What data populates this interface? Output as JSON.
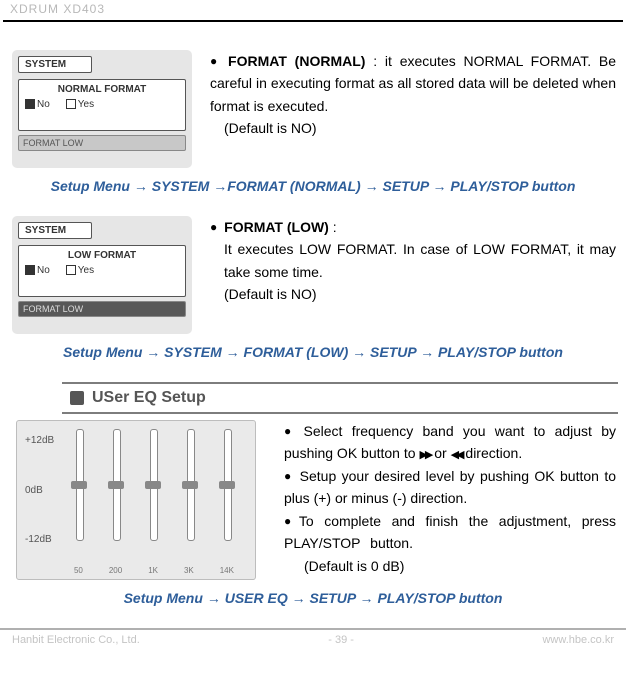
{
  "header": {
    "product": "XDRUM XD403"
  },
  "sections": {
    "format_normal": {
      "thumb": {
        "panel": "SYSTEM",
        "title": "NORMAL FORMAT",
        "opt_no": "No",
        "opt_yes": "Yes",
        "footer": "FORMAT LOW"
      },
      "heading": "FORMAT (NORMAL)",
      "body_line1": " : it executes NORMAL FORMAT. Be careful in executing format as all stored data will be deleted when format is executed.",
      "default": "(Default is NO)"
    },
    "format_low": {
      "thumb": {
        "panel": "SYSTEM",
        "title": "LOW FORMAT",
        "opt_no": "No",
        "opt_yes": "Yes",
        "footer": "FORMAT LOW"
      },
      "heading": "FORMAT (LOW)",
      "heading_suffix": " :",
      "body_line1": "It executes LOW FORMAT. In case of LOW FORMAT, it may take some time.",
      "default": "(Default is NO)"
    },
    "user_eq": {
      "bar_title": "USer EQ Setup",
      "thumb": {
        "labels": {
          "top": "+12dB",
          "mid": "  0dB",
          "bot": "-12dB"
        },
        "freqs": [
          "50",
          "200",
          "1K",
          "3K",
          "14K"
        ]
      },
      "bullet1": "Select frequency band you want to adjust by pushing OK button to ",
      "bullet1_mid": " or ",
      "bullet1_end": " direction.",
      "bullet2": "Setup your desired level by pushing OK button to plus (+) or minus (-) direction.",
      "bullet3": "To complete and finish the adjustment, press PLAY/STOP button.",
      "default": "(Default is 0 dB)"
    }
  },
  "paths": {
    "p1": {
      "a": "Setup Menu",
      "b": "SYSTEM",
      "c": "FORMAT (NORMAL)",
      "d": "SETUP",
      "e": "PLAY/STOP button"
    },
    "p2": {
      "a": "Setup Menu",
      "b": "SYSTEM",
      "c": "FORMAT (LOW)",
      "d": "SETUP",
      "e": "PLAY/STOP button"
    },
    "p3": {
      "a": "Setup Menu",
      "b": "USER EQ",
      "c": "SETUP",
      "d": "PLAY/STOP button"
    }
  },
  "footer": {
    "company": "Hanbit Electronic Co., Ltd.",
    "page_prefix": "- ",
    "page": "39",
    "page_suffix": " -",
    "url": "www.hbe.co.kr"
  }
}
